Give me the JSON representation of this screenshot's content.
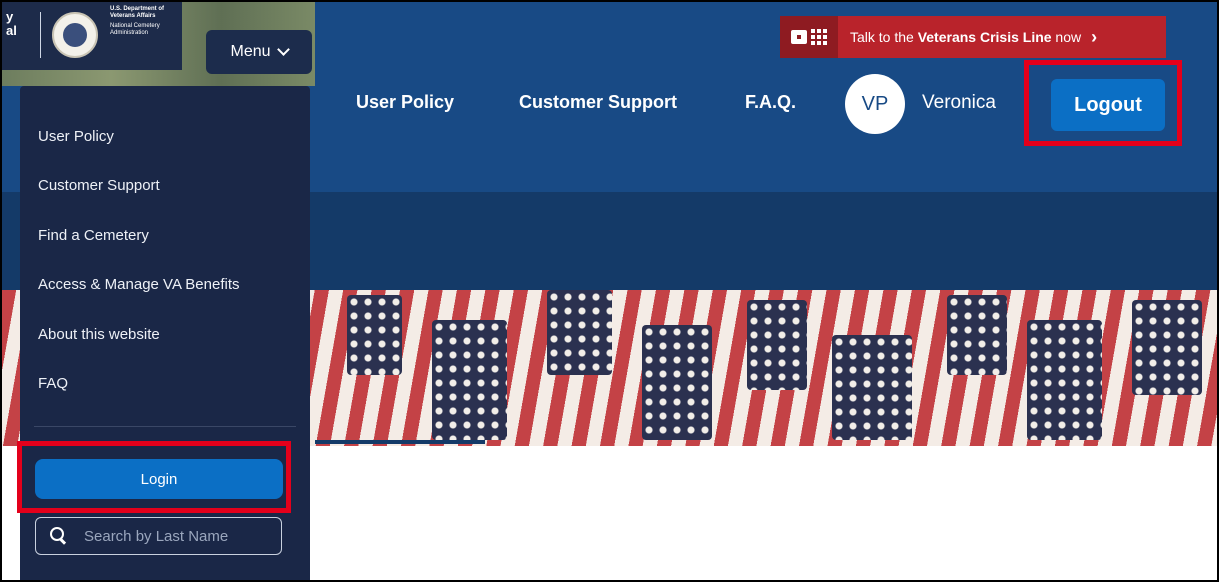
{
  "logo": {
    "partial_text": "y\nal",
    "agency_lines": "U.S. Department of Veterans Affairs",
    "admin_lines": "National Cemetery Administration"
  },
  "menu": {
    "label": "Menu"
  },
  "crisis": {
    "prefix": "Talk to the ",
    "bold": "Veterans Crisis Line",
    "suffix": " now",
    "arrow": "›"
  },
  "nav": {
    "items": [
      "User Policy",
      "Customer Support",
      "F.A.Q."
    ],
    "avatar_initials": "VP",
    "user_name": "Veronica",
    "logout_label": "Logout"
  },
  "sidebar": {
    "items": [
      "User Policy",
      "Customer Support",
      "Find a Cemetery",
      "Access & Manage VA Benefits",
      "About this website",
      "FAQ"
    ],
    "login_label": "Login",
    "search_placeholder": "Search by Last Name"
  },
  "colors": {
    "header_blue": "#184a85",
    "sidebar_navy": "#1a2747",
    "button_blue": "#0b6fc5",
    "highlight_red": "#e3001b",
    "crisis_red": "#b9232b"
  }
}
